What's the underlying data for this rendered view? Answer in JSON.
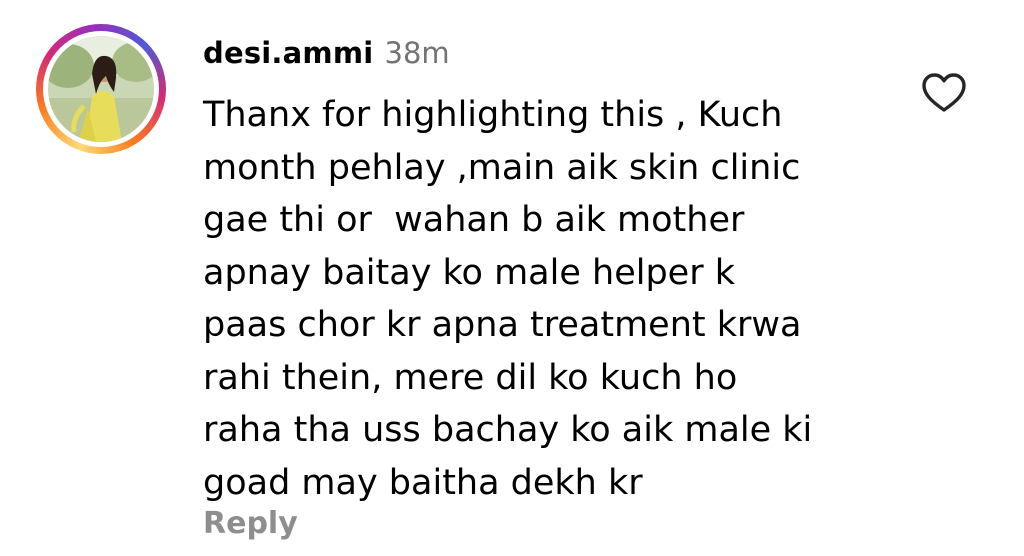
{
  "comment": {
    "username": "desi.ammi",
    "time_ago": "38m",
    "lines": [
      "Thanx for highlighting this , Kuch",
      "month pehlay ,main aik skin clinic",
      "gae thi or  wahan b aik mother",
      "apnay baitay ko male helper k",
      "paas chor kr apna treatment krwa",
      "rahi thein, mere dil ko kuch ho",
      "raha tha uss bachay ko aik male ki",
      "goad may baitha dekh kr"
    ],
    "reply_label": "Reply",
    "like_icon": "heart-outline-icon",
    "avatar_icon": "profile-photo-icon"
  },
  "colors": {
    "text": "#000000",
    "timestamp": "#737373",
    "reply": "#8e8e8e",
    "ring_start": "#feda75",
    "ring_mid": "#d62976",
    "ring_end": "#4f5bd5"
  }
}
